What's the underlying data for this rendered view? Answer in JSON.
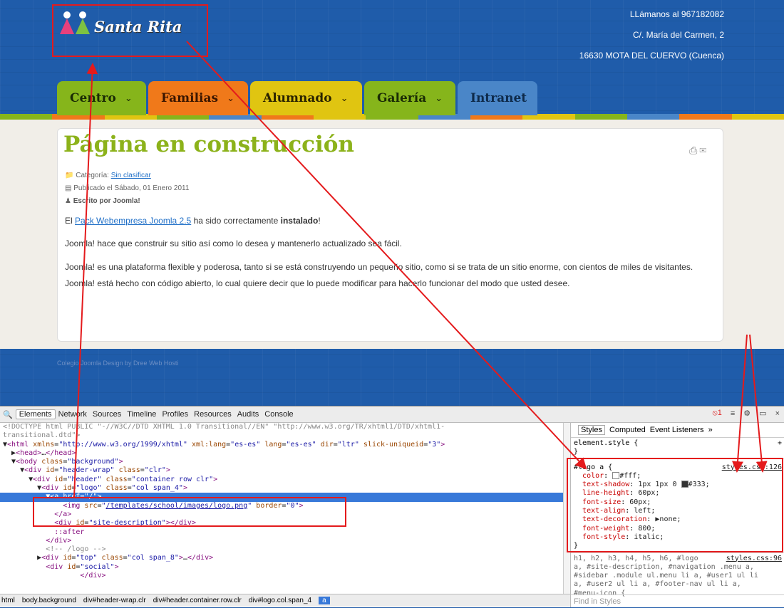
{
  "site": {
    "logo_text": "Santa Rita",
    "contact": [
      "LLámanos al 967182082",
      "C/. María del Carmen, 2",
      "16630 MOTA DEL CUERVO (Cuenca)"
    ],
    "nav": [
      {
        "label": "Centro",
        "chevron": "⌄",
        "color": "#86b51b"
      },
      {
        "label": "Familias",
        "chevron": "⌄",
        "color": "#f0791a"
      },
      {
        "label": "Alumnado",
        "chevron": "⌄",
        "color": "#e0c511"
      },
      {
        "label": "Galería",
        "chevron": "⌄",
        "color": "#86b51b"
      },
      {
        "label": "Intranet",
        "chevron": "",
        "color": "#4a86c8"
      }
    ],
    "article": {
      "title": "Página en construcción",
      "category_label": "Categoría:",
      "category_link": "Sin clasificar",
      "published": "Publicado el Sábado, 01 Enero 2011",
      "author": "Escrito por Joomla!",
      "p1_pre": "El",
      "p1_link": "Pack Webempresa Joomla 2.5",
      "p1_mid": "ha sido correctamente",
      "p1_bold": "instalado",
      "p1_end": "!",
      "p2": "Joomla! hace que construir su sitio así como lo desea y mantenerlo actualizado sea fácil.",
      "p3": "Joomla! es una plataforma flexible y poderosa, tanto si se está construyendo un pequeño sitio, como si se trata de un sitio enorme, con cientos de miles de visitantes.",
      "p4": "Joomla! está hecho con código abierto, lo cual quiere decir que lo puede modificar para hacerlo funcionar del modo que usted desee."
    },
    "footer_credit": "Colegio Joomla Design by Dree Web Hosti"
  },
  "devtools": {
    "tabs": [
      "Elements",
      "Network",
      "Sources",
      "Timeline",
      "Profiles",
      "Resources",
      "Audits",
      "Console"
    ],
    "error_count": "1",
    "breadcrumb": [
      "html",
      "body.background",
      "div#header-wrap.clr",
      "div#header.container.row.clr",
      "div#logo.col.span_4",
      "a"
    ],
    "styles_tabs": [
      "Styles",
      "Computed",
      "Event Listeners"
    ],
    "element_style": "element.style {",
    "rule": {
      "selector": "#logo a {",
      "source": "styles.css:126",
      "props": [
        {
          "name": "color",
          "value": "#fff;",
          "swatch": "#ffffff"
        },
        {
          "name": "text-shadow",
          "value": "1px 1px 0 ",
          "value2": "#333;",
          "swatch": "#333333"
        },
        {
          "name": "line-height",
          "value": "60px;"
        },
        {
          "name": "font-size",
          "value": "60px;"
        },
        {
          "name": "text-align",
          "value": "left;"
        },
        {
          "name": "text-decoration",
          "value": "▶none;"
        },
        {
          "name": "font-weight",
          "value": "800;"
        },
        {
          "name": "font-style",
          "value": "italic;"
        }
      ]
    },
    "rule2_source": "styles.css:96",
    "rule2_text": "h1, h2, h3, h4, h5, h6, #logo\na, #site-description, #navigation .menu a,\n#sidebar .module ul.menu li a, #user1 ul li\na, #user2 ul li a, #footer-nav ul li a,\n#menu-icon {",
    "find_placeholder": "Find in Styles",
    "dom": {
      "l1": "<!DOCTYPE html PUBLIC \"-//W3C//DTD XHTML 1.0 Transitional//EN\" \"http://www.w3.org/TR/xhtml1/DTD/xhtml1-",
      "l2": "transitional.dtd\">",
      "img_src": "/templates/school/images/logo.png"
    }
  }
}
